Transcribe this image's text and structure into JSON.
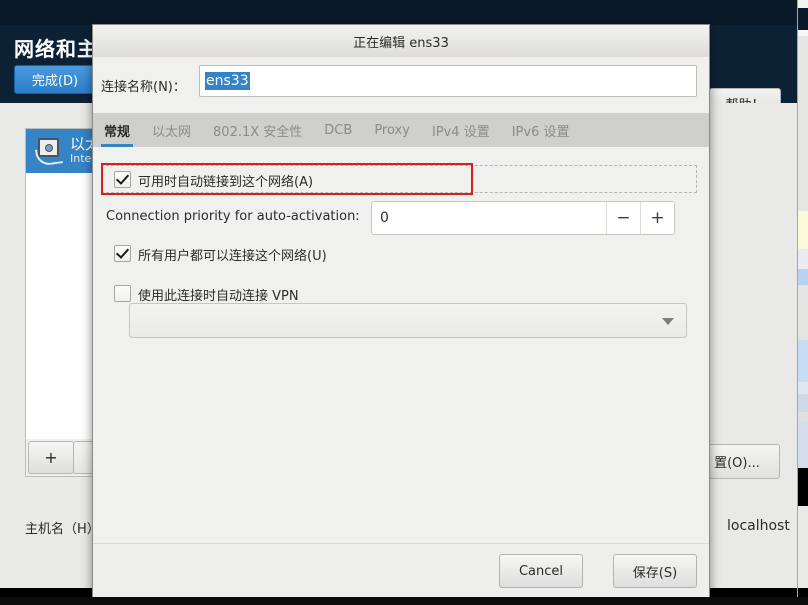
{
  "background_window": {
    "title": "网络和主机名",
    "done_button": "完成(D)",
    "help_button": "帮助！",
    "device_list": [
      {
        "icon": "ethernet-icon",
        "name": "以太网",
        "detail": "Intel ("
      }
    ],
    "toolbar": {
      "add_label": "+",
      "remove_label": "–"
    },
    "configure_button": "置(O)...",
    "hostname_label": "主机名（H）",
    "hostname_separator": ":",
    "hostname_value": "localhost"
  },
  "dialog": {
    "title": "正在编辑 ens33",
    "connection_name": {
      "label": "连接名称(N)：",
      "value": "ens33",
      "placeholder": ""
    },
    "tabs": [
      {
        "label": "常规",
        "active": true
      },
      {
        "label": "以太网",
        "active": false
      },
      {
        "label": "802.1X 安全性",
        "active": false
      },
      {
        "label": "DCB",
        "active": false
      },
      {
        "label": "Proxy",
        "active": false
      },
      {
        "label": "IPv4 设置",
        "active": false
      },
      {
        "label": "IPv6 设置",
        "active": false
      }
    ],
    "general": {
      "autoconnect": {
        "label": "可用时自动链接到这个网络(A)",
        "checked": true,
        "highlighted": true
      },
      "priority": {
        "label": "Connection priority for auto-activation:",
        "value": "0",
        "decrement_label": "−",
        "increment_label": "+"
      },
      "all_users": {
        "label": "所有用户都可以连接这个网络(U)",
        "checked": true
      },
      "auto_vpn": {
        "label": "使用此连接时自动连接 VPN",
        "checked": false
      },
      "vpn_select": {
        "value": "",
        "arrow_icon": "chevron-down-icon"
      }
    },
    "footer": {
      "cancel_label": "Cancel",
      "save_label": "保存(S)"
    }
  },
  "colors": {
    "accent": "#3584c6",
    "header_dark": "#0d2135",
    "highlight_red": "#d81f1f",
    "dialog_bg": "#f0f0ee"
  }
}
